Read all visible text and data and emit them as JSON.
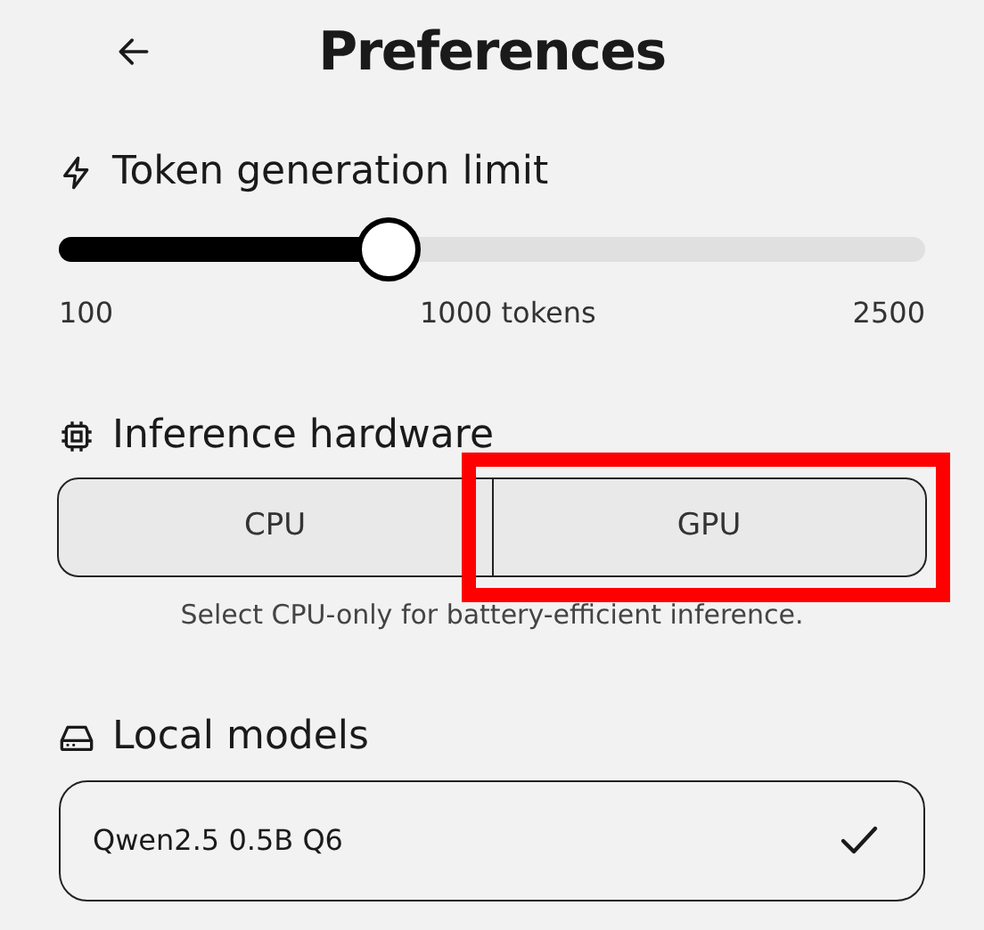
{
  "header": {
    "title": "Preferences"
  },
  "token_limit": {
    "label": "Token generation limit",
    "level": 0.38,
    "min_label": "100",
    "value_label": "1000 tokens",
    "max_label": "2500"
  },
  "hardware": {
    "label": "Inference hardware",
    "options": [
      {
        "label": "CPU",
        "highlighted": false
      },
      {
        "label": "GPU",
        "highlighted": true
      }
    ],
    "caption": "Select CPU-only for battery-efficient inference."
  },
  "local_models": {
    "label": "Local models",
    "items": [
      {
        "name": "Qwen2.5 0.5B Q6",
        "selected": true
      }
    ]
  }
}
